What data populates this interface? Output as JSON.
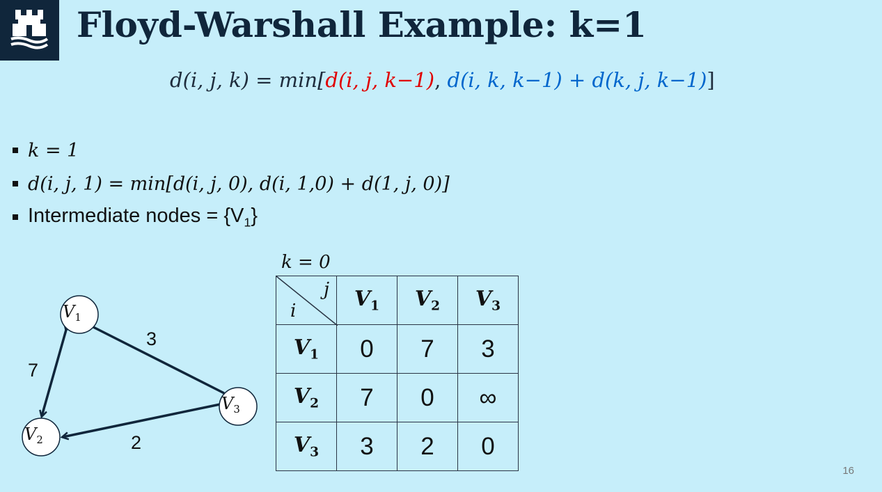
{
  "slide": {
    "title": "Floyd-Warshall Example: k=1",
    "page_number": "16",
    "colors": {
      "background": "#c6eefa",
      "title": "#10263b",
      "logo_bg": "#10263b",
      "highlight_red": "#e00000",
      "highlight_blue": "#0066cc"
    }
  },
  "logo": {
    "icon": "castle-tower-icon"
  },
  "formula": {
    "lhs": "d(i, j, k) = min[",
    "red_term": "d(i, j, k−1)",
    "sep": ", ",
    "blue_term": "d(i, k, k−1) + d(k, j, k−1)",
    "close": "]"
  },
  "bullets": [
    {
      "text": "k = 1"
    },
    {
      "text": "d(i, j, 1) = min[d(i, j, 0), d(i, 1,0) + d(1, j, 0)]"
    },
    {
      "prefix": "Intermediate nodes = {V",
      "sub": "1",
      "suffix": "}"
    }
  ],
  "table": {
    "caption": "k = 0",
    "corner_row_label": "i",
    "corner_col_label": "j",
    "column_headers": [
      {
        "base": "V",
        "sub": "1"
      },
      {
        "base": "V",
        "sub": "2"
      },
      {
        "base": "V",
        "sub": "3"
      }
    ],
    "rows": [
      {
        "header": {
          "base": "V",
          "sub": "1"
        },
        "cells": [
          "0",
          "7",
          "3"
        ]
      },
      {
        "header": {
          "base": "V",
          "sub": "2"
        },
        "cells": [
          "7",
          "0",
          "∞"
        ]
      },
      {
        "header": {
          "base": "V",
          "sub": "3"
        },
        "cells": [
          "3",
          "2",
          "0"
        ]
      }
    ]
  },
  "graph": {
    "nodes": [
      {
        "base": "V",
        "sub": "1"
      },
      {
        "base": "V",
        "sub": "2"
      },
      {
        "base": "V",
        "sub": "3"
      }
    ],
    "edges": [
      {
        "from": "V1",
        "to": "V3",
        "weight": "3",
        "directed": false
      },
      {
        "from": "V1",
        "to": "V2",
        "weight": "7",
        "directed": "both"
      },
      {
        "from": "V3",
        "to": "V2",
        "weight": "2",
        "directed": true
      }
    ]
  }
}
